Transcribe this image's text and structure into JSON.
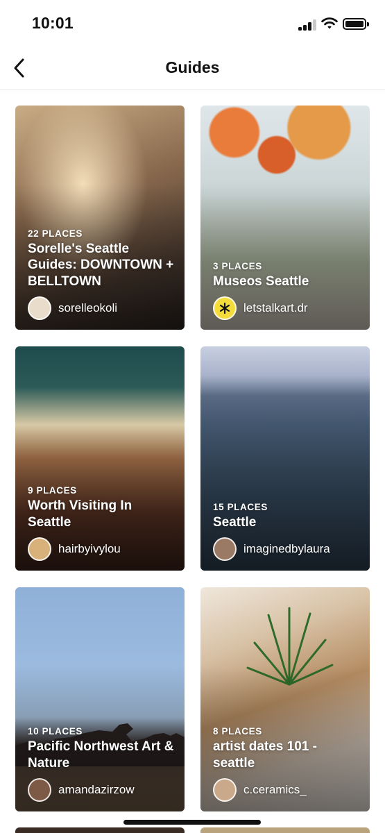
{
  "status_bar": {
    "time": "10:01",
    "icons": [
      "cellular-signal-icon",
      "wifi-icon",
      "battery-icon"
    ]
  },
  "nav": {
    "back_icon": "chevron-left-icon",
    "title": "Guides"
  },
  "guides": [
    {
      "count": "22 PLACES",
      "title": "Sorelle's Seattle Guides: DOWNTOWN + BELLTOWN",
      "author": "sorelleokoli",
      "avatar_color": "#e9dccb"
    },
    {
      "count": "3 PLACES",
      "title": "Museos Seattle",
      "author": "letstalkart.dr",
      "avatar_color": "#f4dd3a"
    },
    {
      "count": "9 PLACES",
      "title": "Worth Visiting In Seattle",
      "author": "hairbyivylou",
      "avatar_color": "#d8b07a"
    },
    {
      "count": "15 PLACES",
      "title": "Seattle",
      "author": "imaginedbylaura",
      "avatar_color": "#9a7a64"
    },
    {
      "count": "10 PLACES",
      "title": "Pacific Northwest Art & Nature",
      "author": "amandazirzow",
      "avatar_color": "#7d5a46"
    },
    {
      "count": "8 PLACES",
      "title": "artist dates 101 - seattle",
      "author": "c.ceramics_",
      "avatar_color": "#caa88a"
    }
  ]
}
